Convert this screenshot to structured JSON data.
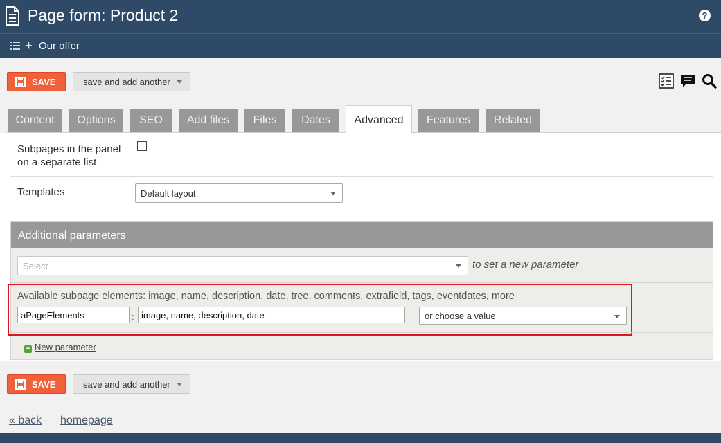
{
  "header": {
    "title": "Page form: Product 2",
    "help_label": "?",
    "doc_icon": "document-icon"
  },
  "breadcrumb": {
    "label": "Our offer"
  },
  "toolbar": {
    "save_label": "SAVE",
    "save_and_add_label": "save and add another",
    "icons": [
      "checklist-icon",
      "comment-icon",
      "search-icon"
    ]
  },
  "tabs": [
    {
      "label": "Content"
    },
    {
      "label": "Options"
    },
    {
      "label": "SEO"
    },
    {
      "label": "Add files"
    },
    {
      "label": "Files"
    },
    {
      "label": "Dates"
    },
    {
      "label": "Advanced",
      "active": true
    },
    {
      "label": "Features"
    },
    {
      "label": "Related"
    }
  ],
  "form": {
    "subpages_label": "Subpages in the panel on a separate list",
    "subpages_checked": false,
    "templates_label": "Templates",
    "templates_value": "Default layout"
  },
  "parameters": {
    "heading": "Additional parameters",
    "select_placeholder": "Select",
    "select_hint": "to set a new parameter",
    "available_text": "Available subpage elements: image, name, description, date, tree, comments, extrafield, tags, eventdates, more",
    "param_name": "aPageElements",
    "param_separator": ":",
    "param_value": "image, name, description, date",
    "choose_value": "or choose a value",
    "new_parameter_label": "New parameter"
  },
  "footer": {
    "back_label": "« back",
    "homepage_label": "homepage"
  },
  "colors": {
    "header_bg": "#2e4a66",
    "save_bg": "#f0603a",
    "tab_bg": "#989898",
    "highlight": "#e0141e"
  }
}
